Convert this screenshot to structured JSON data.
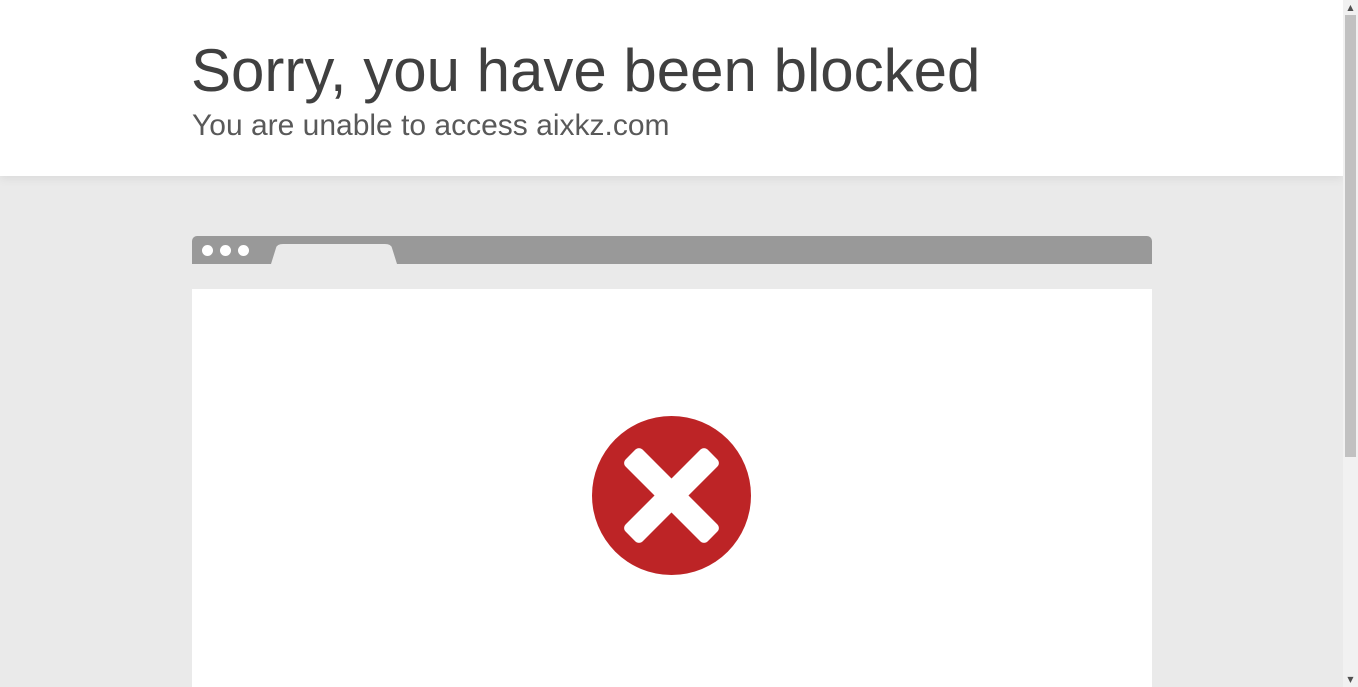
{
  "header": {
    "title": "Sorry, you have been blocked",
    "subtitle": "You are unable to access aixkz.com"
  },
  "illustration": {
    "icon": "blocked-x-icon",
    "icon_color": "#bd2426",
    "bar_color": "#999999"
  },
  "colors": {
    "page_background": "#eaeaea",
    "header_background": "#ffffff",
    "title_text": "#404040",
    "subtitle_text": "#595959"
  },
  "scrollbar": {
    "up_glyph": "▲",
    "down_glyph": "▼"
  }
}
